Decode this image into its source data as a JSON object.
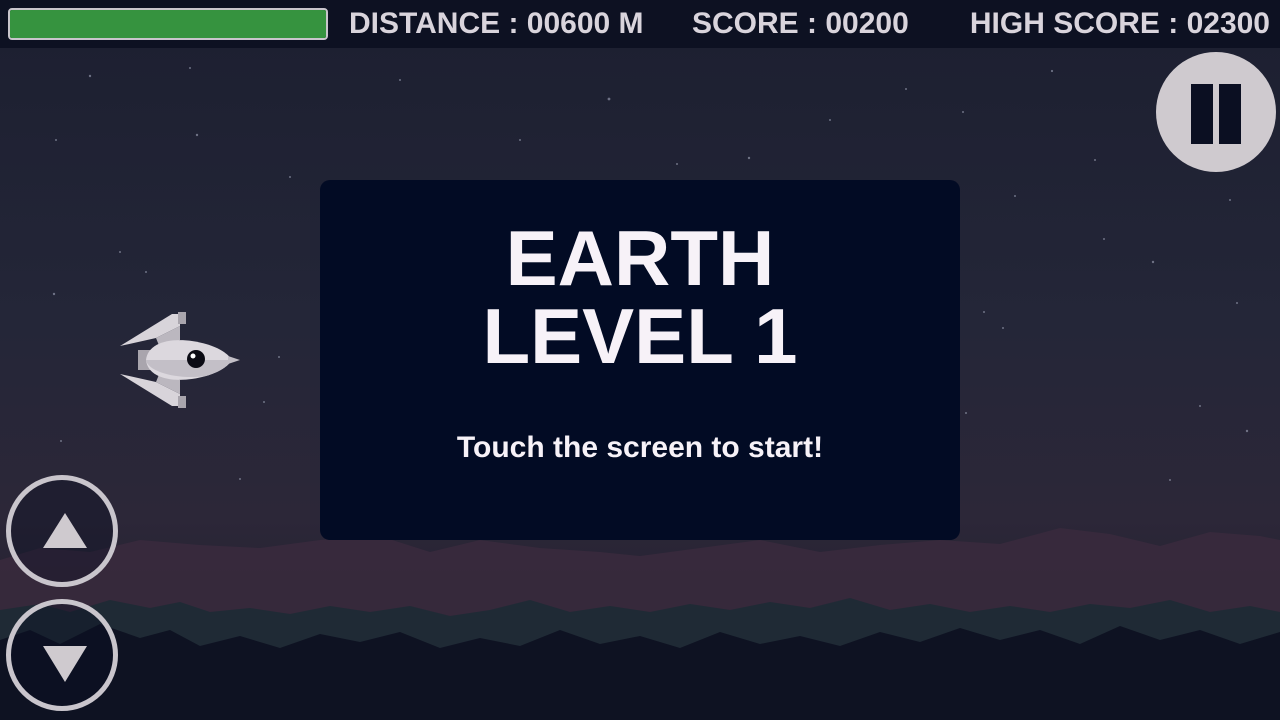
{
  "hud": {
    "health_fraction": 1.0,
    "health_color": "#36933f",
    "distance": "DISTANCE : 00600 M",
    "score": "SCORE : 00200",
    "high_score": "HIGH SCORE : 02300"
  },
  "panel": {
    "world": "EARTH",
    "level": "LEVEL 1",
    "prompt": "Touch the screen to start!"
  },
  "controls": {
    "pause_icon": "pause-icon",
    "up_icon": "up-arrow-icon",
    "down_icon": "down-arrow-icon"
  },
  "colors": {
    "panel_bg": "#020b24",
    "hud_bg": "#0d1122",
    "button_light": "#cfcacf"
  }
}
